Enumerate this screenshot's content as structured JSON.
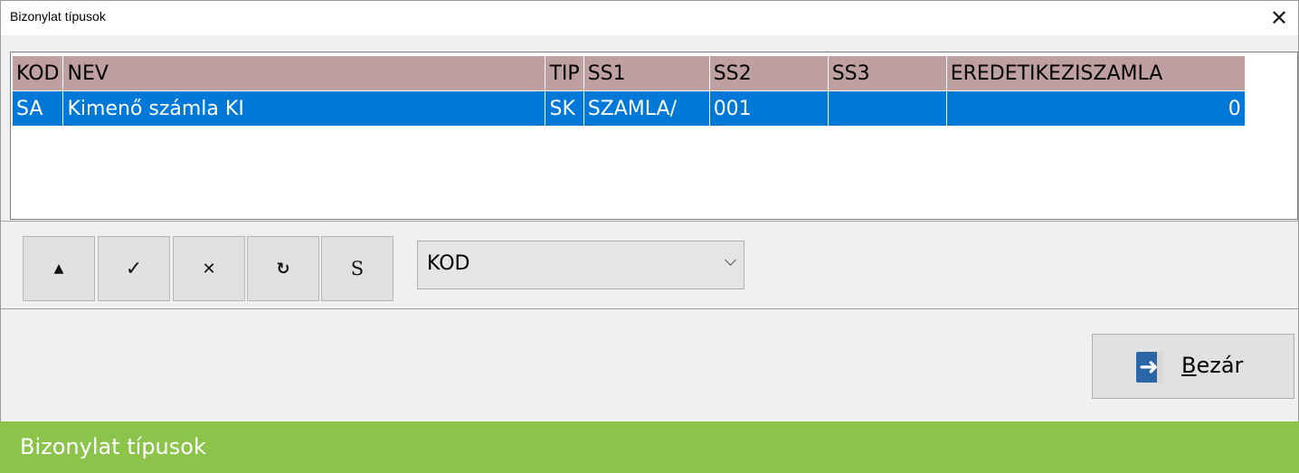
{
  "window": {
    "title": "Bizonylat típusok",
    "close_symbol": "✕"
  },
  "grid": {
    "columns": [
      "KOD",
      "NEV",
      "TIP",
      "SS1",
      "SS2",
      "SS3",
      "EREDETIKEZISZAMLA"
    ],
    "rows": [
      [
        "SA",
        "Kimenő számla KI",
        "SK",
        "SZAMLA/",
        "001",
        "",
        "0"
      ]
    ]
  },
  "toolbar": {
    "buttons": [
      "▲",
      "✓",
      "✕",
      "↻",
      "S"
    ]
  },
  "sort_select": {
    "value": "KOD"
  },
  "close_button": {
    "accel": "B",
    "rest": "ezár"
  },
  "footer": {
    "text": "Bizonylat típusok"
  },
  "colors": {
    "header_bg": "#bfa0a0",
    "selected_row_bg": "#0078d7",
    "footer_bg": "#8cc34b"
  }
}
